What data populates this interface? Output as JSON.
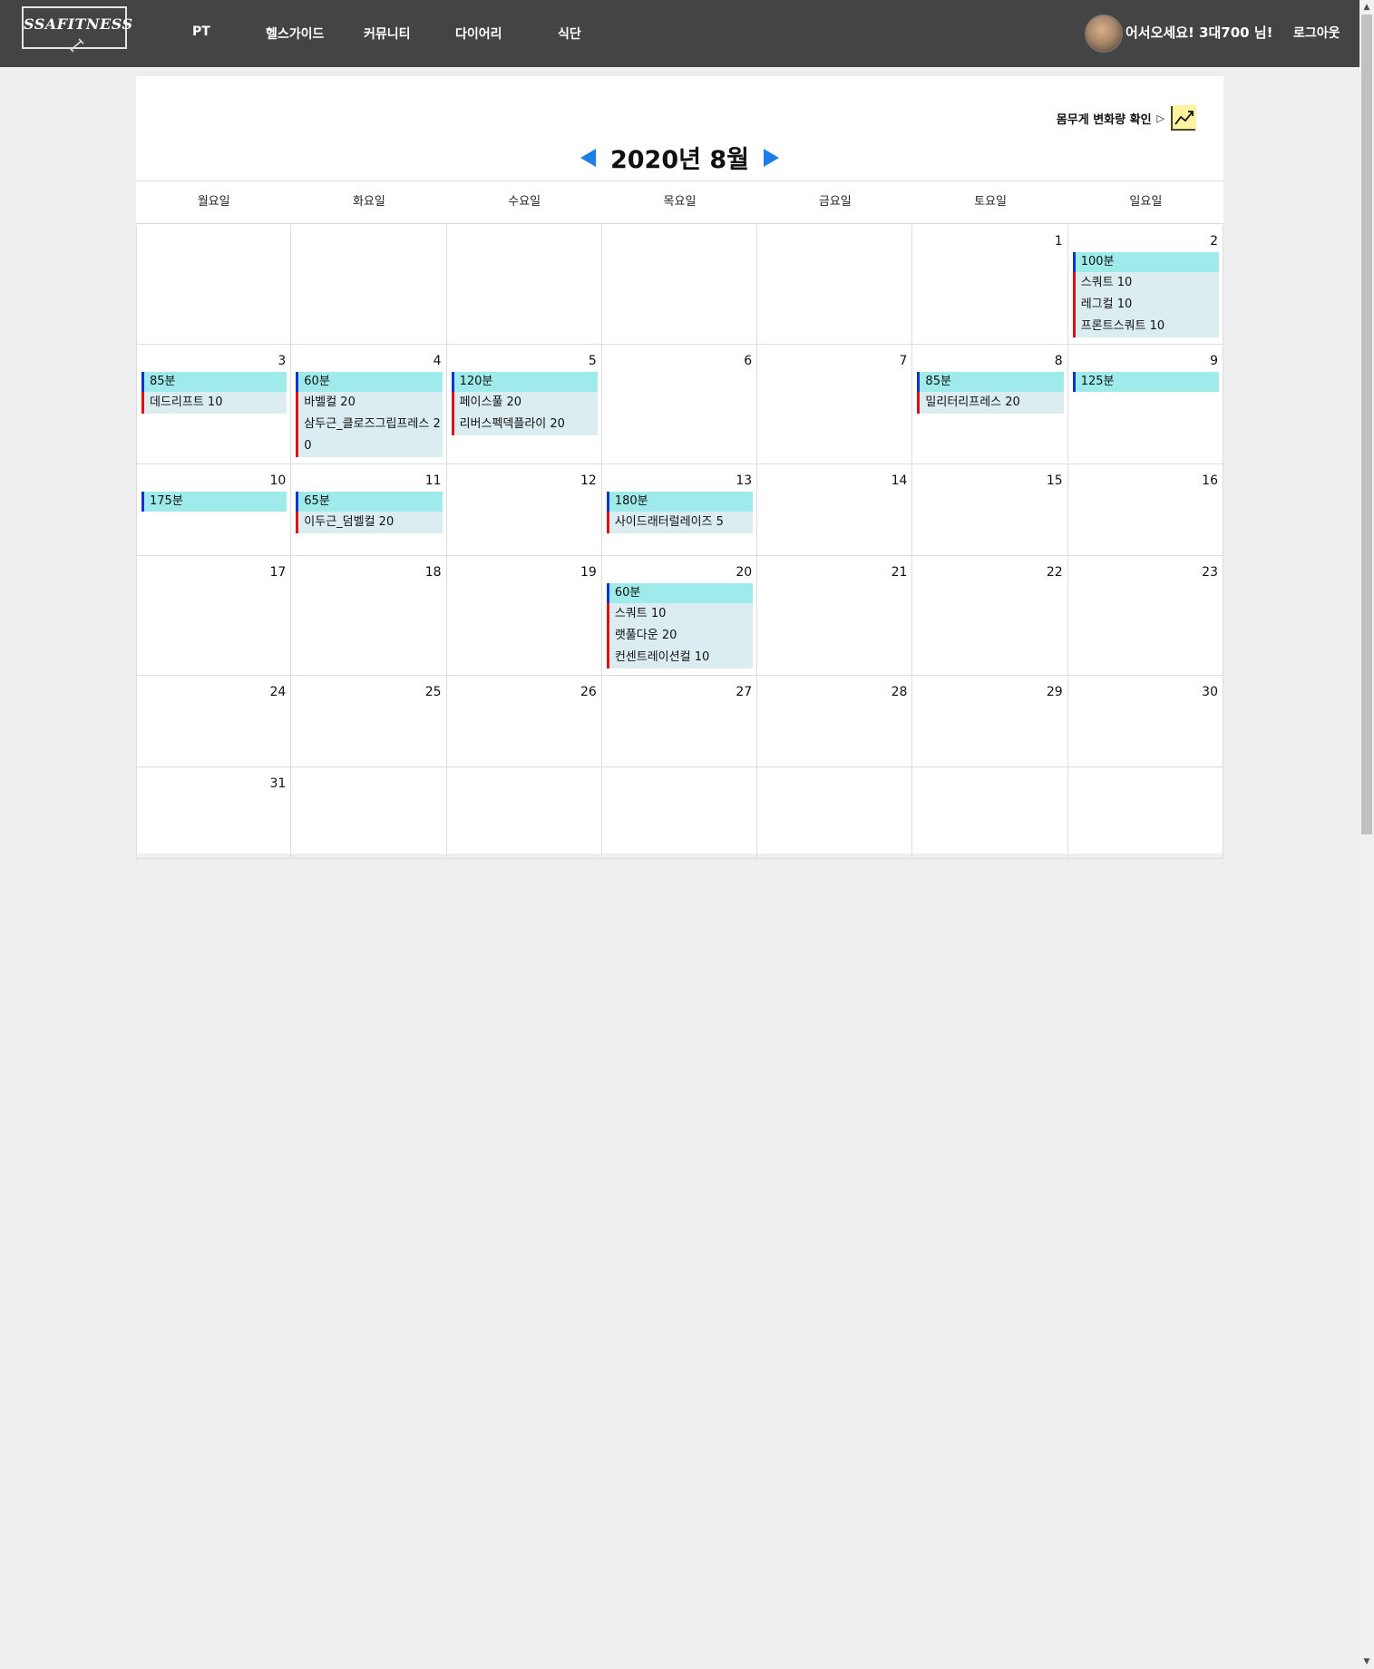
{
  "nav": {
    "logo_text": "SSAFITNESS",
    "links": [
      "PT",
      "헬스가이드",
      "커뮤니티",
      "다이어리",
      "식단"
    ],
    "welcome": "어서오세요! 3대700 님!",
    "logout": "로그아웃"
  },
  "calendar": {
    "weight_link": "몸무게 변화량 확인",
    "weight_arrow": "▷",
    "month_title": "2020년 8월",
    "weekdays": [
      "월요일",
      "화요일",
      "수요일",
      "목요일",
      "금요일",
      "토요일",
      "일요일"
    ],
    "weeks": [
      [
        {
          "day": "",
          "duration": "",
          "exercises": []
        },
        {
          "day": "",
          "duration": "",
          "exercises": []
        },
        {
          "day": "",
          "duration": "",
          "exercises": []
        },
        {
          "day": "",
          "duration": "",
          "exercises": []
        },
        {
          "day": "",
          "duration": "",
          "exercises": []
        },
        {
          "day": "1",
          "duration": "",
          "exercises": []
        },
        {
          "day": "2",
          "duration": "100분",
          "exercises": [
            "스쿼트 10",
            "레그컬 10",
            "프론트스쿼트 10"
          ]
        }
      ],
      [
        {
          "day": "3",
          "duration": "85분",
          "exercises": [
            "데드리프트 10"
          ]
        },
        {
          "day": "4",
          "duration": "60분",
          "exercises": [
            "바벨컬 20",
            "삼두근_클로즈그립프레스 20"
          ]
        },
        {
          "day": "5",
          "duration": "120분",
          "exercises": [
            "페이스풀 20",
            "리버스펙덱플라이 20"
          ]
        },
        {
          "day": "6",
          "duration": "",
          "exercises": []
        },
        {
          "day": "7",
          "duration": "",
          "exercises": []
        },
        {
          "day": "8",
          "duration": "85분",
          "exercises": [
            "밀리터리프레스 20"
          ]
        },
        {
          "day": "9",
          "duration": "125분",
          "exercises": []
        }
      ],
      [
        {
          "day": "10",
          "duration": "175분",
          "exercises": []
        },
        {
          "day": "11",
          "duration": "65분",
          "exercises": [
            "이두근_덤벨컬 20"
          ]
        },
        {
          "day": "12",
          "duration": "",
          "exercises": []
        },
        {
          "day": "13",
          "duration": "180분",
          "exercises": [
            "사이드래터럴레이즈 5"
          ]
        },
        {
          "day": "14",
          "duration": "",
          "exercises": []
        },
        {
          "day": "15",
          "duration": "",
          "exercises": []
        },
        {
          "day": "16",
          "duration": "",
          "exercises": []
        }
      ],
      [
        {
          "day": "17",
          "duration": "",
          "exercises": []
        },
        {
          "day": "18",
          "duration": "",
          "exercises": []
        },
        {
          "day": "19",
          "duration": "",
          "exercises": []
        },
        {
          "day": "20",
          "duration": "60분",
          "exercises": [
            "스쿼트 10",
            "랫풀다운 20",
            "컨센트레이션컬 10"
          ]
        },
        {
          "day": "21",
          "duration": "",
          "exercises": []
        },
        {
          "day": "22",
          "duration": "",
          "exercises": []
        },
        {
          "day": "23",
          "duration": "",
          "exercises": []
        }
      ],
      [
        {
          "day": "24",
          "duration": "",
          "exercises": []
        },
        {
          "day": "25",
          "duration": "",
          "exercises": []
        },
        {
          "day": "26",
          "duration": "",
          "exercises": []
        },
        {
          "day": "27",
          "duration": "",
          "exercises": []
        },
        {
          "day": "28",
          "duration": "",
          "exercises": []
        },
        {
          "day": "29",
          "duration": "",
          "exercises": []
        },
        {
          "day": "30",
          "duration": "",
          "exercises": []
        }
      ],
      [
        {
          "day": "31",
          "duration": "",
          "exercises": []
        },
        {
          "day": "",
          "duration": "",
          "exercises": []
        },
        {
          "day": "",
          "duration": "",
          "exercises": []
        },
        {
          "day": "",
          "duration": "",
          "exercises": []
        },
        {
          "day": "",
          "duration": "",
          "exercises": []
        },
        {
          "day": "",
          "duration": "",
          "exercises": []
        },
        {
          "day": "",
          "duration": "",
          "exercises": []
        }
      ]
    ]
  },
  "icons": {
    "logo": "dumbbell-icon",
    "prev": "triangle-left-icon",
    "next": "triangle-right-icon",
    "weight_chart": "trending-up-chart-icon"
  },
  "colors": {
    "navbar": "#444444",
    "accent_arrow": "#1e7ee8",
    "duration_bg": "#9feaea",
    "duration_bar": "#1133cc",
    "exercise_bg": "#dbedf1",
    "exercise_bar": "#dd1111",
    "chart_icon_bg": "#fff3a0"
  }
}
